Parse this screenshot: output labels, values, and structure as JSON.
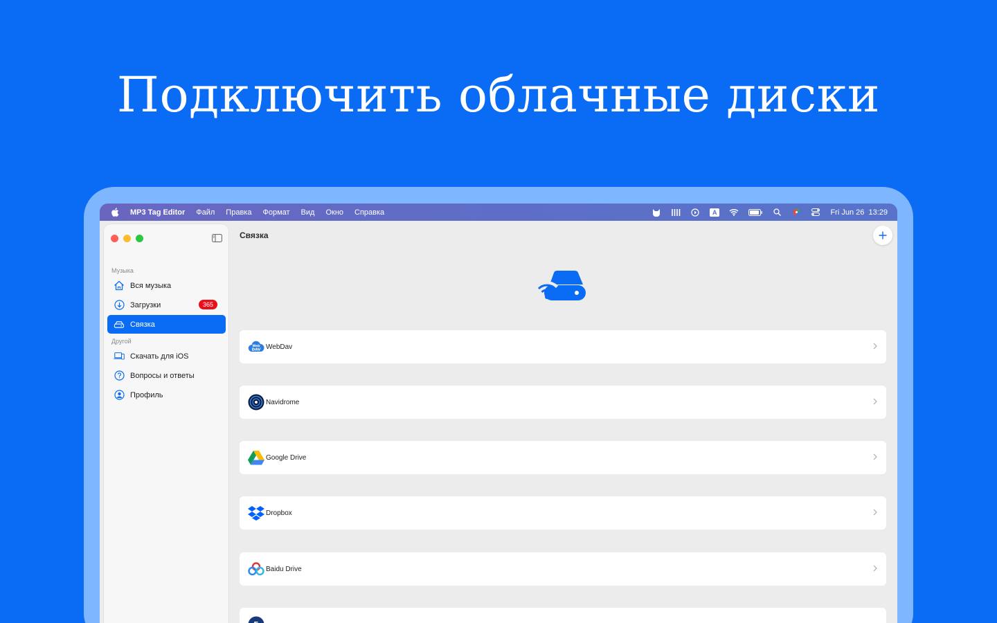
{
  "headline": "Подключить облачные диски",
  "menubar": {
    "app_name": "MP3 Tag Editor",
    "menus": [
      "Файл",
      "Правка",
      "Формат",
      "Вид",
      "Окно",
      "Справка"
    ],
    "input_source": "A",
    "datetime": "Fri Jun 26  13:29",
    "status_icons": [
      "cat-icon",
      "mixer-icon",
      "play-circle-icon",
      "input-source-icon",
      "wifi-icon",
      "battery-icon",
      "search-icon",
      "color-wheel-icon",
      "control-center-icon"
    ]
  },
  "sidebar": {
    "section_music": "Музыка",
    "section_other": "Другой",
    "items": [
      {
        "label": "Вся музыка",
        "icon": "home-icon"
      },
      {
        "label": "Загрузки",
        "icon": "download-icon",
        "badge": "365"
      },
      {
        "label": "Связка",
        "icon": "drive-icon",
        "active": true
      },
      {
        "label": "Скачать для iOS",
        "icon": "devices-icon"
      },
      {
        "label": "Вопросы и ответы",
        "icon": "question-icon"
      },
      {
        "label": "Профиль",
        "icon": "profile-icon"
      }
    ]
  },
  "main": {
    "title": "Связка",
    "services": [
      {
        "label": "WebDav",
        "icon": "webdav-icon"
      },
      {
        "label": "Navidrome",
        "icon": "navidrome-icon"
      },
      {
        "label": "Google Drive",
        "icon": "google-drive-icon"
      },
      {
        "label": "Dropbox",
        "icon": "dropbox-icon"
      },
      {
        "label": "Baidu Drive",
        "icon": "baidu-drive-icon"
      },
      {
        "label": "",
        "icon": "partial-service-icon"
      }
    ]
  },
  "colors": {
    "background": "#0a6cf5",
    "device_frame": "#7eb6ff",
    "accent": "#0a6cf5",
    "badge": "#e8101a"
  }
}
